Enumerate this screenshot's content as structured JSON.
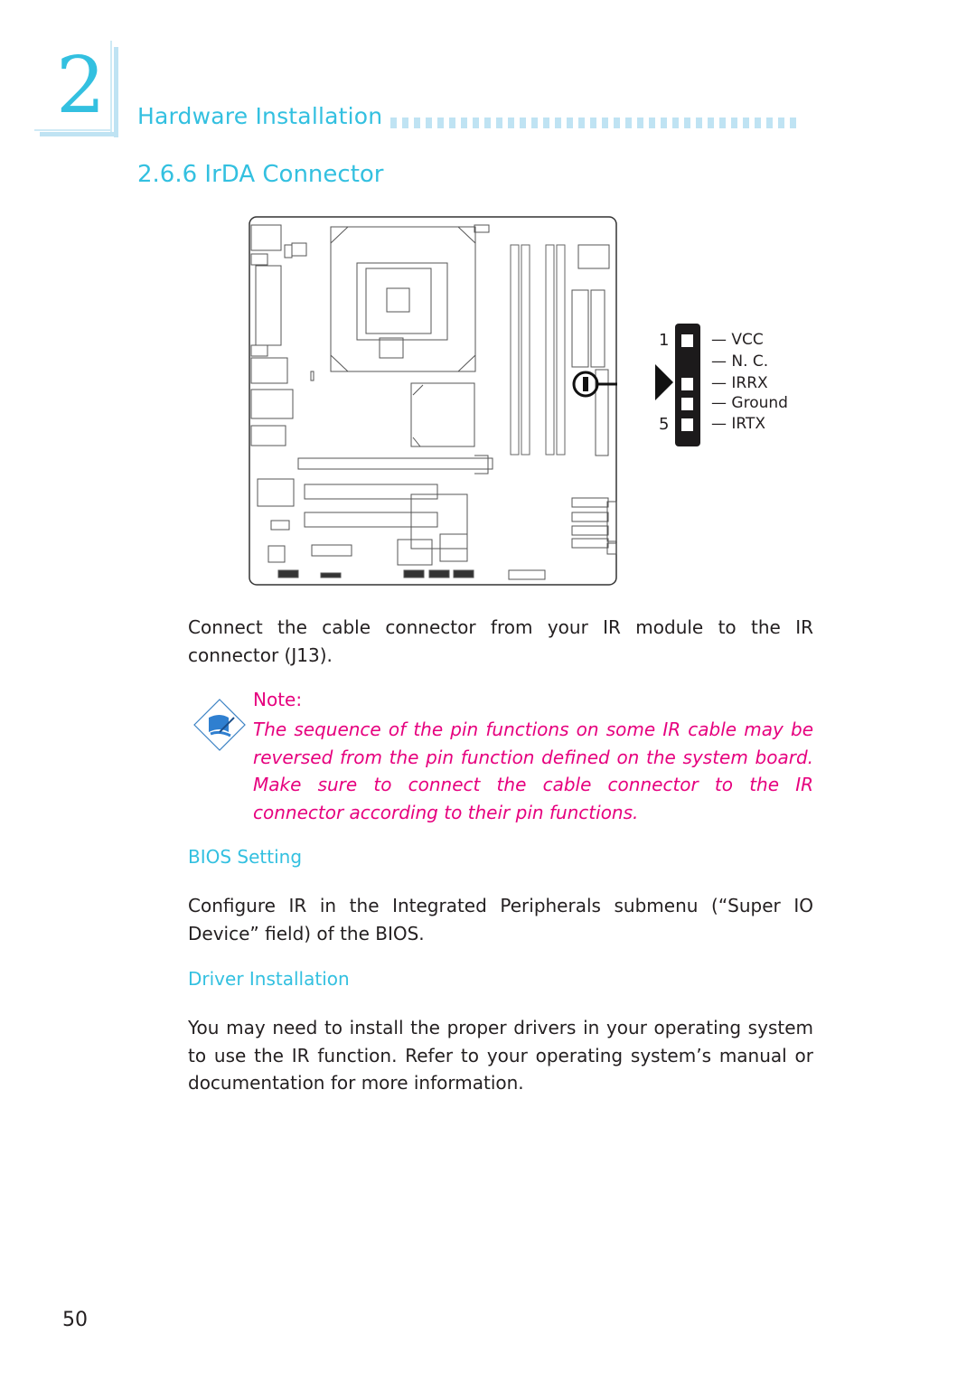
{
  "header": {
    "chapter_number": "2",
    "chapter_title": "Hardware Installation",
    "section_title": "2.6.6  IrDA Connector"
  },
  "diagram": {
    "pinout": {
      "pins": [
        {
          "number": "1",
          "label": "VCC",
          "populated": true
        },
        {
          "number": "",
          "label": "N. C.",
          "populated": false
        },
        {
          "number": "",
          "label": "IRRX",
          "populated": true
        },
        {
          "number": "",
          "label": "Ground",
          "populated": true
        },
        {
          "number": "5",
          "label": "IRTX",
          "populated": true
        }
      ]
    }
  },
  "body": {
    "intro": "Connect the cable connector from your IR module to the IR connector (J13).",
    "note_label": "Note:",
    "note_text": "The sequence of the pin functions on some IR cable may be reversed from the pin function defined on the system board. Make sure to connect the cable connector to the IR connector according to their pin functions.",
    "bios_heading": "BIOS Setting",
    "bios_text": "Configure IR in the Integrated Peripherals submenu (“Super IO Device” field) of the BIOS.",
    "driver_heading": "Driver Installation",
    "driver_text": "You may need to install the proper drivers in your operating system to use the IR function. Refer to your operating system’s manual or documentation for more information."
  },
  "footer": {
    "page_number": "50"
  },
  "colors": {
    "accent_cyan": "#33c0e0",
    "accent_light": "#bfe3f3",
    "note_magenta": "#e6007e",
    "body_text": "#231f20"
  }
}
